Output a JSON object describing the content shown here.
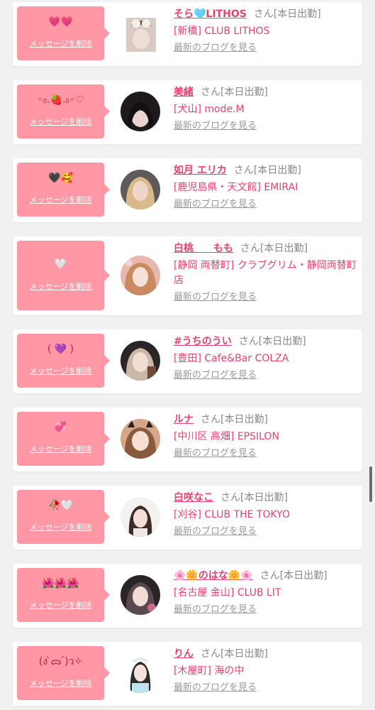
{
  "common": {
    "delete_label": "メッセージを削除",
    "san_label": "さん",
    "status_label": "[本日出勤]",
    "blog_label": "最新のブログを見る"
  },
  "cards": [
    {
      "message": "💗💗",
      "name": "そら🩵LITHOS",
      "shop": "[新橋] CLUB LITHOS",
      "avatar": "girl-photo"
    },
    {
      "message": "◦₀.🍓.₀◦♡",
      "name": "美緒",
      "shop": "[犬山] mode.M",
      "avatar": "girl-photo"
    },
    {
      "message": "🖤🥰",
      "name": "如月 エリカ",
      "shop": "[鹿児島県・天文館] EMIRAI",
      "avatar": "girl-photo"
    },
    {
      "message": "🤍",
      "name": "白桃　　もも",
      "shop": "[静岡 両替町] クラブグリム・静岡両替町店",
      "avatar": "girl-photo"
    },
    {
      "message": "( 💜 )",
      "name": "#うちのうい",
      "shop": "[豊田] Cafe&Bar COLZA",
      "avatar": "girl-photo"
    },
    {
      "message": "💞",
      "name": "ルナ",
      "shop": "[中川区 高畑] EPSILON",
      "avatar": "girl-photo"
    },
    {
      "message": "🥀🤍",
      "name": "白咲なこ",
      "shop": "[刈谷] CLUB THE TOKYO",
      "avatar": "girl-photo"
    },
    {
      "message": "🌺🌺🌺",
      "name": "🌸🌼のはな🌼🌸",
      "shop": "[名古屋 金山] CLUB LIT",
      "avatar": "girl-photo"
    },
    {
      "message": "(ง ̀ᯅ ́)ว✧",
      "name": "りん",
      "shop": "[木屋町] 海の中",
      "avatar": "girl-photo"
    }
  ],
  "colors": {
    "bubble": "#ff97a4",
    "name": "#e8426e",
    "muted": "#888888",
    "background": "#f1f1f1"
  }
}
